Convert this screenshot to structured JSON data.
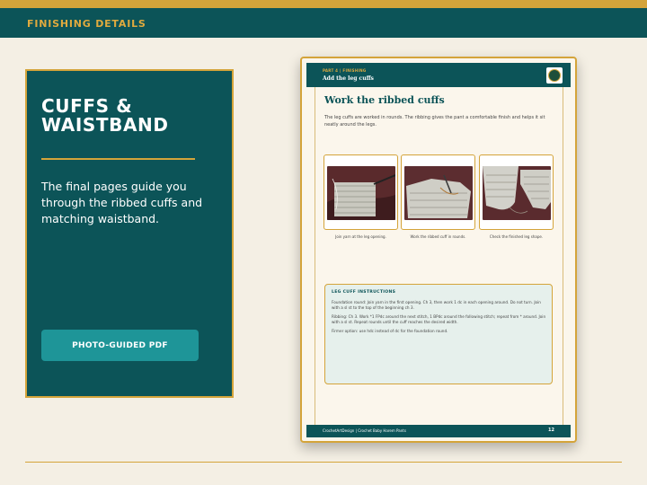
{
  "header": {
    "section_title": "FINISHING DETAILS"
  },
  "card": {
    "title": "CUFFS & WAISTBAND",
    "description": "The final pages guide you through the ribbed cuffs and matching waistband.",
    "button_label": "PHOTO-GUIDED PDF"
  },
  "page": {
    "header_sub": "PART 4 | FINISHING",
    "header_title": "Add the leg cuffs",
    "logo_icon": "pattern-logo-icon",
    "title": "Work the ribbed cuffs",
    "intro": "The leg cuffs are worked in rounds. The ribbing gives the pant a comfortable finish and helps it sit neatly around the legs.",
    "photos": [
      {
        "caption": "Join yarn at the leg opening."
      },
      {
        "caption": "Work the ribbed cuff in rounds."
      },
      {
        "caption": "Check the finished leg shape."
      }
    ],
    "instructions": {
      "title": "LEG CUFF INSTRUCTIONS",
      "paragraphs": [
        "Foundation round: Join yarn in the first opening. Ch 3, then work 1 dc in each opening around. Do not turn. Join with a sl st to the top of the beginning ch 3.",
        "Ribbing: Ch 3. Work *1 FPdc around the next stitch, 1 BPdc around the following stitch; repeat from * around. Join with a sl st. Repeat rounds until the cuff reaches the desired width.",
        "Firmer option: use hdc instead of dc for the foundation round."
      ]
    },
    "footer_text": "CrochetArtDesign  |  Crochet Baby Harem Pants",
    "page_number": "12"
  },
  "colors": {
    "teal": "#0c5458",
    "gold": "#d4a43a",
    "button_teal": "#1e9598",
    "background": "#f4efe4"
  }
}
